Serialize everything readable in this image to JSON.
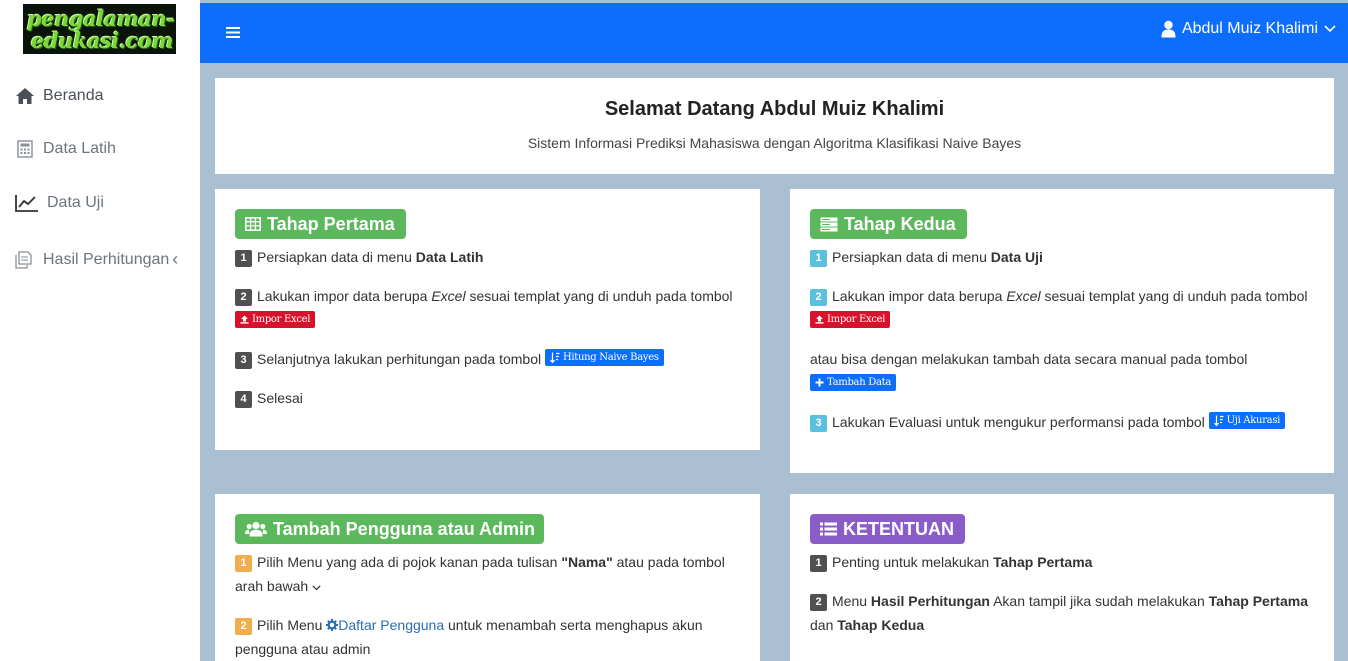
{
  "logo": {
    "line1": "pengalaman-",
    "line2": "edukasi.com"
  },
  "sidebar": {
    "items": [
      {
        "label": "Beranda",
        "icon": "home-icon"
      },
      {
        "label": "Data Latih",
        "icon": "calculator-icon"
      },
      {
        "label": "Data Uji",
        "icon": "line-chart-icon"
      },
      {
        "label": "Hasil Perhitungan",
        "icon": "copy-icon",
        "chevron": "‹"
      }
    ]
  },
  "topbar": {
    "user_name": "Abdul Muiz Khalimi"
  },
  "welcome": {
    "title": "Selamat Datang Abdul Muiz Khalimi",
    "subtitle": "Sistem Informasi Prediksi Mahasiswa dengan Algoritma Klasifikasi Naive Bayes"
  },
  "tahap_pertama": {
    "title": "Tahap Pertama",
    "steps": [
      {
        "n": "1",
        "pre": "Persiapkan data di menu ",
        "bold": "Data Latih"
      },
      {
        "n": "2",
        "pre": "Lakukan impor data berupa ",
        "italic": "Excel",
        "post": " sesuai templat yang di unduh pada tombol",
        "button": "Impor Excel"
      },
      {
        "n": "3",
        "pre": "Selanjutnya lakukan perhitungan pada tombol ",
        "button": "Hitung Naive Bayes"
      },
      {
        "n": "4",
        "pre": "Selesai"
      }
    ]
  },
  "tahap_kedua": {
    "title": "Tahap Kedua",
    "steps": [
      {
        "n": "1",
        "pre": "Persiapkan data di menu ",
        "bold": "Data Uji"
      },
      {
        "n": "2",
        "pre": "Lakukan impor data berupa ",
        "italic": "Excel",
        "post": " sesuai templat yang di unduh pada tombol",
        "button": "Impor Excel"
      },
      {
        "pre": "atau bisa dengan melakukan tambah data secara manual pada tombol",
        "button": "Tambah Data"
      },
      {
        "n": "3",
        "pre": "Lakukan Evaluasi untuk mengukur performansi pada tombol ",
        "button": "Uji Akurasi"
      }
    ]
  },
  "tambah_pengguna": {
    "title": "Tambah Pengguna atau Admin",
    "steps": [
      {
        "n": "1",
        "pre": "Pilih Menu yang ada di pojok kanan pada tulisan ",
        "bold": "\"Nama\"",
        "post": " atau pada tombol",
        "line2": "arah bawah"
      },
      {
        "n": "2",
        "pre": "Pilih Menu ",
        "link": "Daftar Pengguna",
        "post": " untuk menambah serta menghapus akun",
        "line2": "pengguna atau admin"
      }
    ]
  },
  "ketentuan": {
    "title": "KETENTUAN",
    "steps": [
      {
        "n": "1",
        "pre": "Penting untuk melakukan ",
        "bold": "Tahap Pertama"
      },
      {
        "n": "2",
        "pre": "Menu ",
        "bold": "Hasil Perhitungan",
        "post": " Akan tampil jika sudah melakukan ",
        "bold2": "Tahap Pertama",
        "line2a": "dan ",
        "line2b": "Tahap Kedua"
      }
    ]
  },
  "colors": {
    "topbar": "#0d6efd",
    "background": "#abbfd3",
    "pill_green": "#5cb85c",
    "pill_purple": "#8a5cc7",
    "button_red": "#d9112c"
  }
}
